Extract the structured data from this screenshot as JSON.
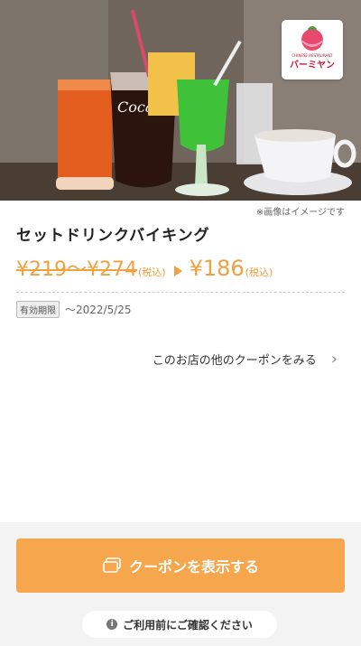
{
  "hero": {
    "image_alt": "drinks photo",
    "logo_tagline": "CHINESE RESTAURANT",
    "logo_name": "バーミヤン",
    "caption": "※画像はイメージです"
  },
  "coupon": {
    "title": "セットドリンクバイキング",
    "old_price": "¥219〜¥274",
    "old_price_tax": "(税込)",
    "new_price": "¥186",
    "new_price_tax": "(税込)",
    "expiry_label": "有効期限",
    "expiry_date": "〜2022/5/25"
  },
  "links": {
    "more_coupons": "このお店の他のクーポンをみる"
  },
  "actions": {
    "show_coupon": "クーポンを表示する",
    "confirm_notice": "ご利用前にご確認ください"
  },
  "colors": {
    "accent": "#f6a64c",
    "price": "#f0a140"
  }
}
